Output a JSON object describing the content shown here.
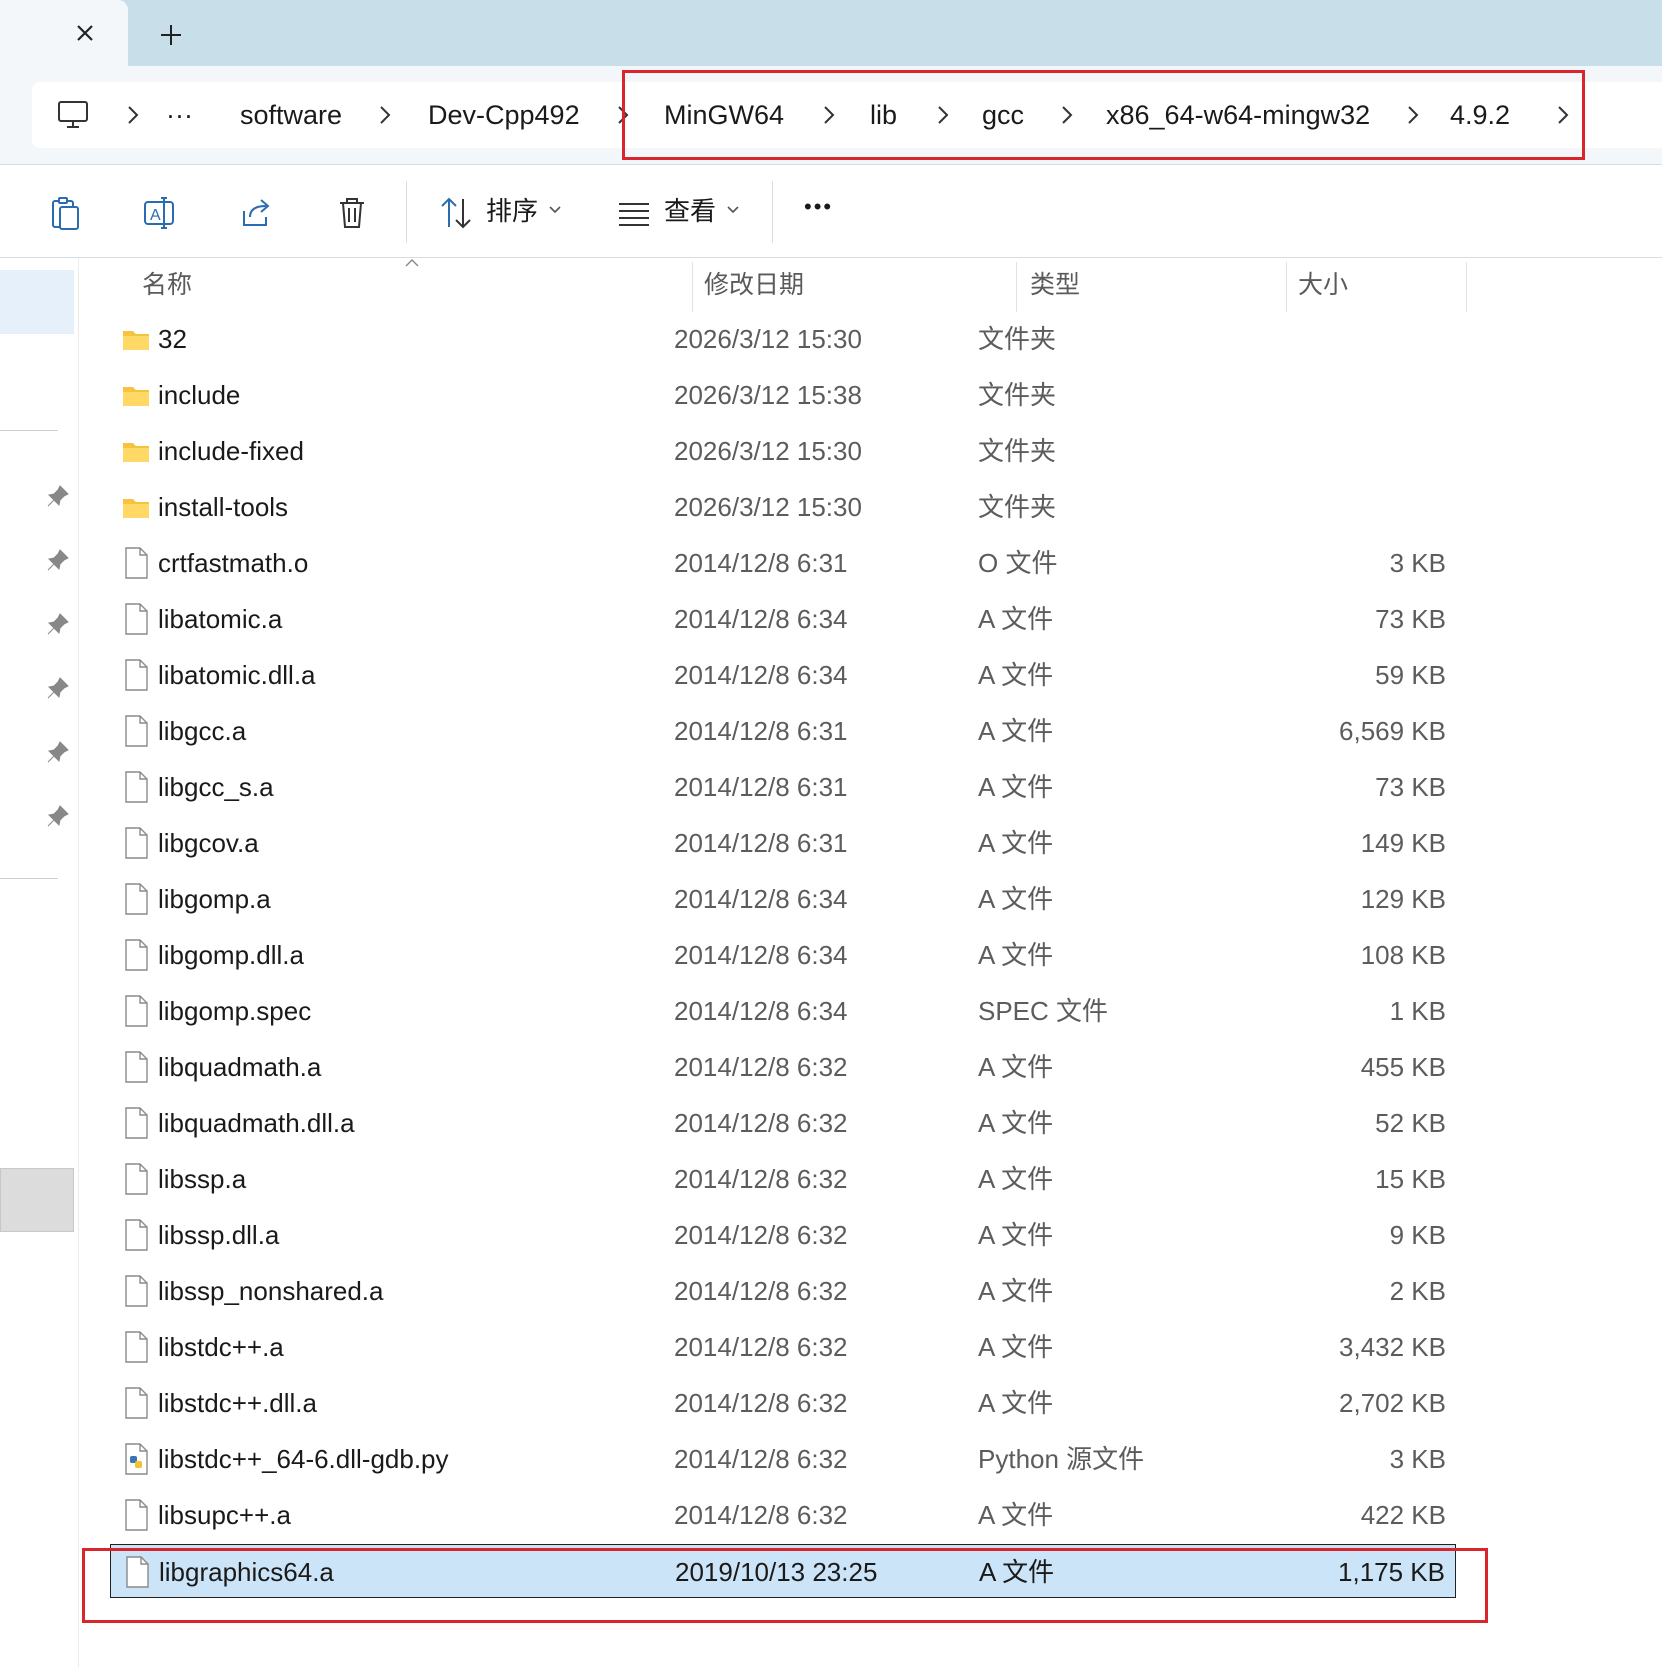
{
  "tabs": {
    "close_label": "×",
    "new_tab_label": "+"
  },
  "breadcrumb": {
    "ellipsis": "···",
    "items": [
      "software",
      "Dev-Cpp492",
      "MinGW64",
      "lib",
      "gcc",
      "x86_64-w64-mingw32",
      "4.9.2"
    ]
  },
  "toolbar": {
    "sort_label": "排序",
    "view_label": "查看",
    "more_label": "•••"
  },
  "columns": {
    "name": "名称",
    "date": "修改日期",
    "type": "类型",
    "size": "大小"
  },
  "files": [
    {
      "name": "32",
      "date": "2026/3/12 15:30",
      "type": "文件夹",
      "size": "",
      "kind": "folder"
    },
    {
      "name": "include",
      "date": "2026/3/12 15:38",
      "type": "文件夹",
      "size": "",
      "kind": "folder"
    },
    {
      "name": "include-fixed",
      "date": "2026/3/12 15:30",
      "type": "文件夹",
      "size": "",
      "kind": "folder"
    },
    {
      "name": "install-tools",
      "date": "2026/3/12 15:30",
      "type": "文件夹",
      "size": "",
      "kind": "folder"
    },
    {
      "name": "crtfastmath.o",
      "date": "2014/12/8 6:31",
      "type": "O 文件",
      "size": "3 KB",
      "kind": "file"
    },
    {
      "name": "libatomic.a",
      "date": "2014/12/8 6:34",
      "type": "A 文件",
      "size": "73 KB",
      "kind": "file"
    },
    {
      "name": "libatomic.dll.a",
      "date": "2014/12/8 6:34",
      "type": "A 文件",
      "size": "59 KB",
      "kind": "file"
    },
    {
      "name": "libgcc.a",
      "date": "2014/12/8 6:31",
      "type": "A 文件",
      "size": "6,569 KB",
      "kind": "file"
    },
    {
      "name": "libgcc_s.a",
      "date": "2014/12/8 6:31",
      "type": "A 文件",
      "size": "73 KB",
      "kind": "file"
    },
    {
      "name": "libgcov.a",
      "date": "2014/12/8 6:31",
      "type": "A 文件",
      "size": "149 KB",
      "kind": "file"
    },
    {
      "name": "libgomp.a",
      "date": "2014/12/8 6:34",
      "type": "A 文件",
      "size": "129 KB",
      "kind": "file"
    },
    {
      "name": "libgomp.dll.a",
      "date": "2014/12/8 6:34",
      "type": "A 文件",
      "size": "108 KB",
      "kind": "file"
    },
    {
      "name": "libgomp.spec",
      "date": "2014/12/8 6:34",
      "type": "SPEC 文件",
      "size": "1 KB",
      "kind": "file"
    },
    {
      "name": "libquadmath.a",
      "date": "2014/12/8 6:32",
      "type": "A 文件",
      "size": "455 KB",
      "kind": "file"
    },
    {
      "name": "libquadmath.dll.a",
      "date": "2014/12/8 6:32",
      "type": "A 文件",
      "size": "52 KB",
      "kind": "file"
    },
    {
      "name": "libssp.a",
      "date": "2014/12/8 6:32",
      "type": "A 文件",
      "size": "15 KB",
      "kind": "file"
    },
    {
      "name": "libssp.dll.a",
      "date": "2014/12/8 6:32",
      "type": "A 文件",
      "size": "9 KB",
      "kind": "file"
    },
    {
      "name": "libssp_nonshared.a",
      "date": "2014/12/8 6:32",
      "type": "A 文件",
      "size": "2 KB",
      "kind": "file"
    },
    {
      "name": "libstdc++.a",
      "date": "2014/12/8 6:32",
      "type": "A 文件",
      "size": "3,432 KB",
      "kind": "file"
    },
    {
      "name": "libstdc++.dll.a",
      "date": "2014/12/8 6:32",
      "type": "A 文件",
      "size": "2,702 KB",
      "kind": "file"
    },
    {
      "name": "libstdc++_64-6.dll-gdb.py",
      "date": "2014/12/8 6:32",
      "type": "Python 源文件",
      "size": "3 KB",
      "kind": "python"
    },
    {
      "name": "libsupc++.a",
      "date": "2014/12/8 6:32",
      "type": "A 文件",
      "size": "422 KB",
      "kind": "file"
    },
    {
      "name": "libgraphics64.a",
      "date": "2019/10/13 23:25",
      "type": "A 文件",
      "size": "1,175 KB",
      "kind": "file",
      "selected": true
    }
  ],
  "colors": {
    "highlight_box": "#d9262c",
    "selection": "#cce4f7",
    "folder": "#f8c33c"
  },
  "icons": [
    "close-icon",
    "add-icon",
    "this-pc-icon",
    "chevron-right-icon",
    "copy-icon",
    "rename-icon",
    "share-icon",
    "delete-icon",
    "sort-icon",
    "view-icon",
    "pin-icon",
    "folder-icon",
    "file-icon",
    "python-file-icon"
  ]
}
